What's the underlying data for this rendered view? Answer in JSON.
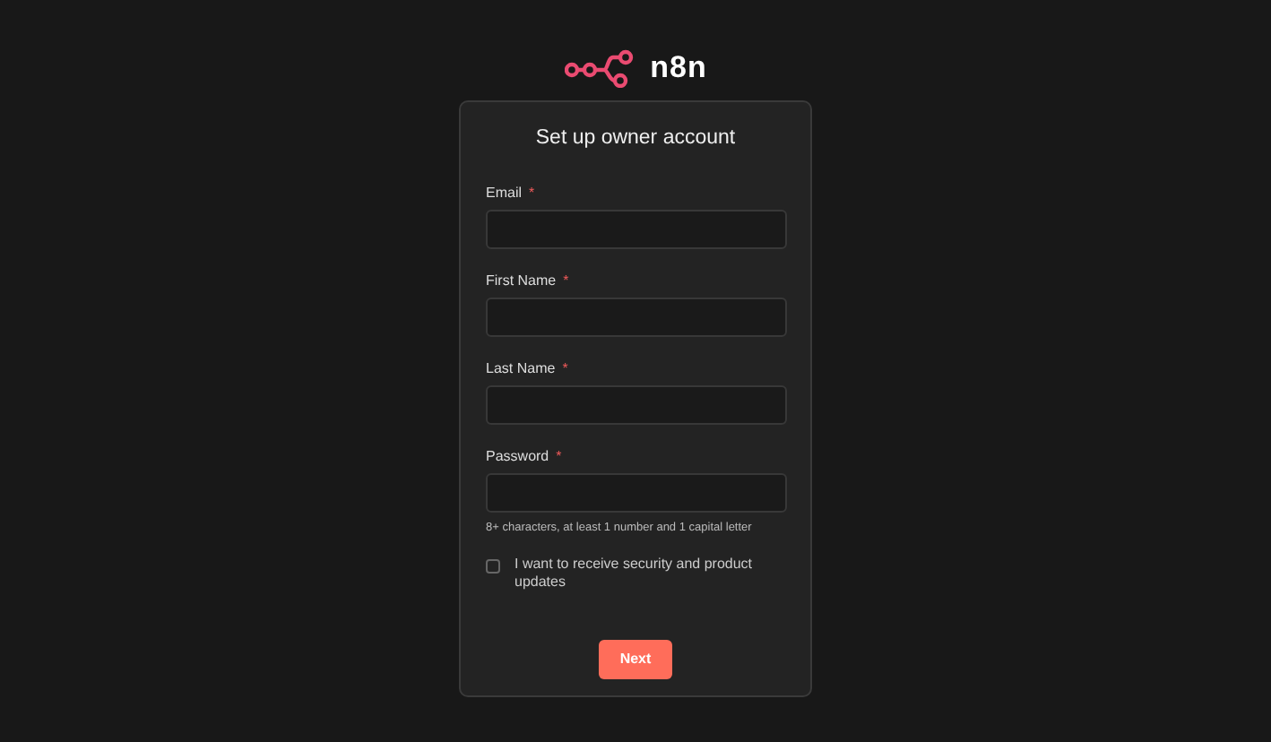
{
  "logo": {
    "text": "n8n"
  },
  "form": {
    "title": "Set up owner account",
    "fields": [
      {
        "label": "Email",
        "required_mark": "*"
      },
      {
        "label": "First Name",
        "required_mark": "*"
      },
      {
        "label": "Last Name",
        "required_mark": "*"
      },
      {
        "label": "Password",
        "required_mark": "*",
        "hint": "8+ characters, at least 1 number and 1 capital letter"
      }
    ],
    "checkbox": {
      "label": "I want to receive security and product updates",
      "checked": false
    },
    "button": "Next"
  }
}
